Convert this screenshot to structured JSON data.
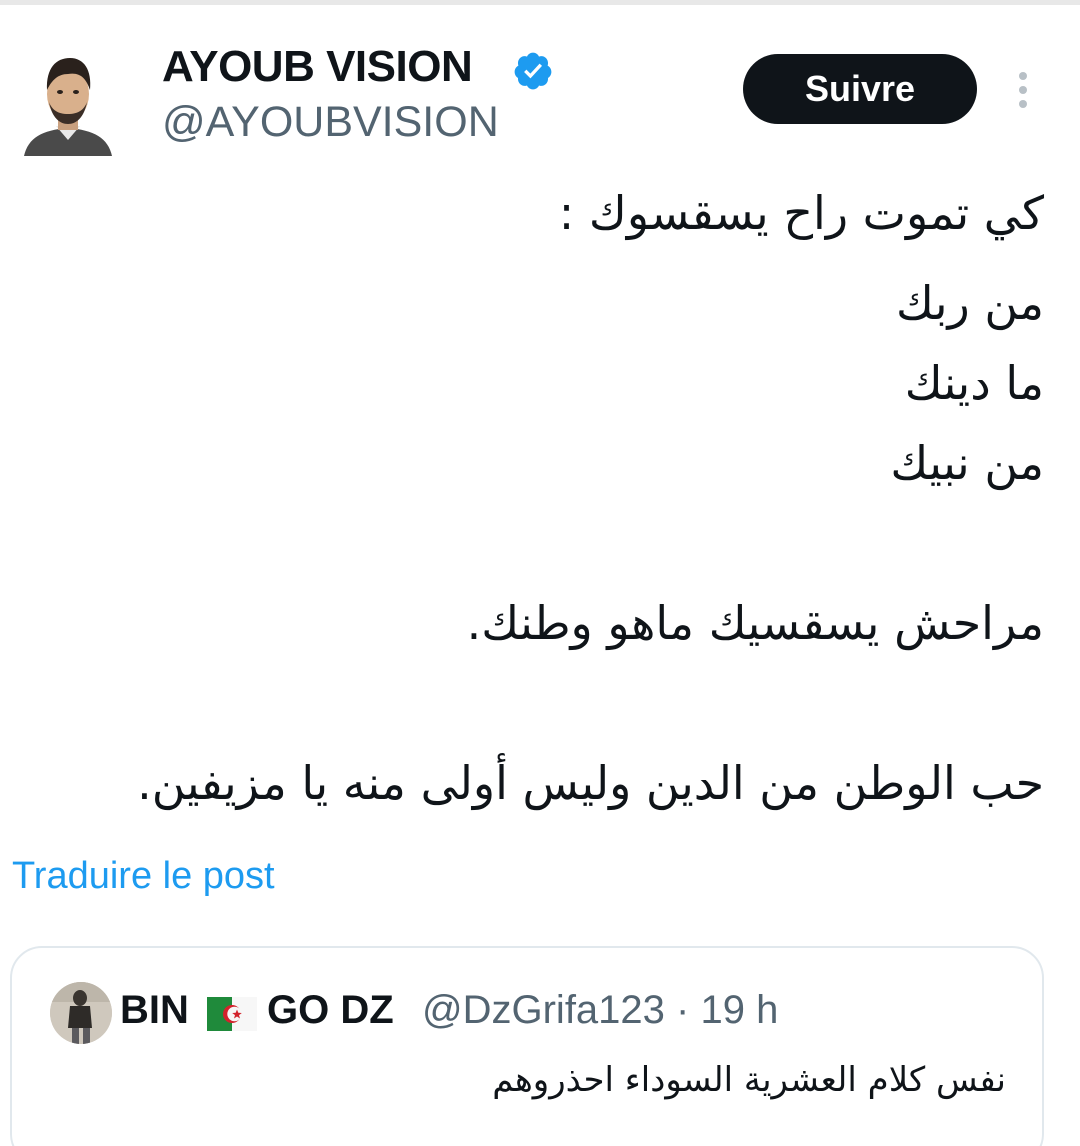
{
  "author": {
    "display_name": "AYOUB VISION",
    "handle": "@AYOUBVISION",
    "verified": true
  },
  "follow_label": "Suivre",
  "more_icon": "more-vertical-icon",
  "tweet_lines": [
    "كي تموت راح يسقسوك :",
    "من ربك",
    "ما دينك",
    "من نبيك",
    "مراحش يسقسيك ماهو وطنك.",
    "حب الوطن من الدين وليس أولى منه يا مزيفين."
  ],
  "translate_label": "Traduire le post",
  "quoted": {
    "name_part1": "BIN",
    "flag": "algeria-flag-icon",
    "name_part2": "GO DZ",
    "handle_time": "@DzGrifa123 · 19 h",
    "text": "نفس كلام العشرية السوداء احذروهم"
  },
  "colors": {
    "text": "#0f1419",
    "secondary": "#536471",
    "link": "#1d9bf0",
    "verified": "#1d9bf0",
    "button_bg": "#0f1419"
  }
}
